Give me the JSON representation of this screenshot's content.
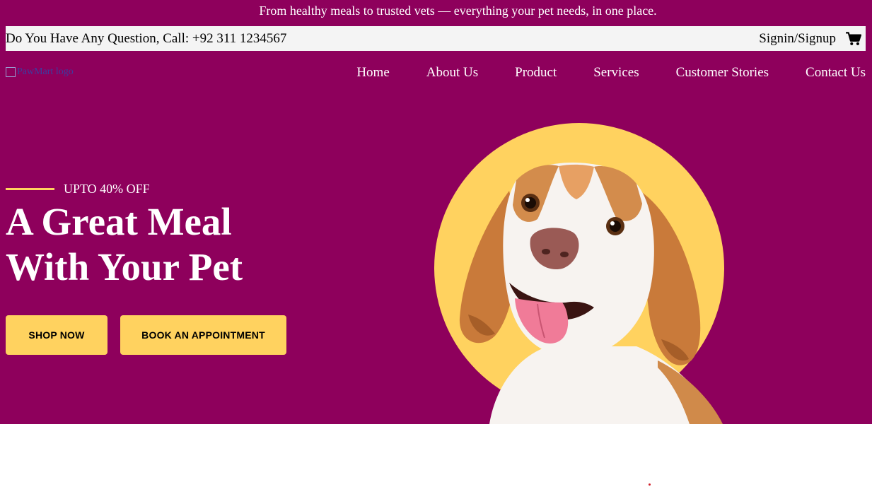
{
  "announcement": "From healthy meals to trusted vets — everything your pet needs, in one place.",
  "contact_bar": {
    "question": "Do You Have Any Question, Call: +92 311 1234567",
    "signin": "Signin/Signup",
    "cart_icon": "cart-icon"
  },
  "logo": {
    "alt": "PawMart logo"
  },
  "nav": [
    "Home",
    "About Us",
    "Product",
    "Services",
    "Customer Stories",
    "Contact Us"
  ],
  "hero": {
    "offer": "UPTO 40% OFF",
    "title_line1": "A Great Meal",
    "title_line2": "With Your Pet",
    "shop_button": "SHOP NOW",
    "book_button": "BOOK AN APPOINTMENT",
    "image": "smiling-dog-on-yellow-circle"
  },
  "colors": {
    "brand": "#8e005c",
    "accent": "#ffd25f",
    "contact_bar_bg": "#f4f4f4",
    "text_light": "#ffffff"
  }
}
